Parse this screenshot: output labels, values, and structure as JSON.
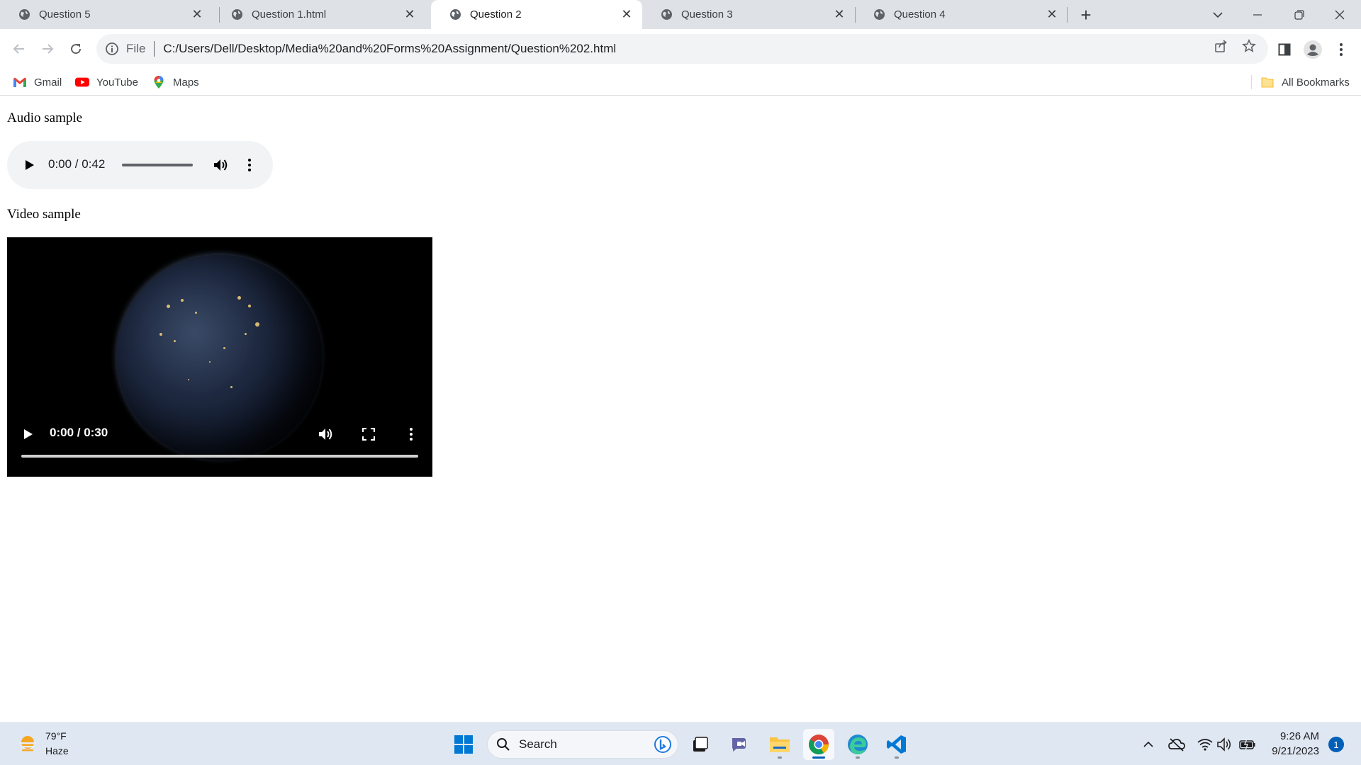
{
  "browser": {
    "tabs": [
      {
        "label": "Question 5",
        "active": false
      },
      {
        "label": "Question 1.html",
        "active": false
      },
      {
        "label": "Question 2",
        "active": true
      },
      {
        "label": "Question 3",
        "active": false
      },
      {
        "label": "Question 4",
        "active": false
      }
    ],
    "close_glyph": "✕",
    "new_tab_glyph": "+",
    "address": {
      "scheme": "File",
      "url": "C:/Users/Dell/Desktop/Media%20and%20Forms%20Assignment/Question%202.html"
    },
    "bookmarks": [
      {
        "label": "Gmail",
        "icon": "gmail-icon"
      },
      {
        "label": "YouTube",
        "icon": "youtube-icon"
      },
      {
        "label": "Maps",
        "icon": "maps-icon"
      }
    ],
    "all_bookmarks_label": "All Bookmarks"
  },
  "page": {
    "audio_heading": "Audio sample",
    "audio": {
      "time": "0:00 / 0:42",
      "progress": 0
    },
    "video_heading": "Video sample",
    "video": {
      "time": "0:00 / 0:30",
      "progress": 0
    }
  },
  "taskbar": {
    "weather": {
      "temp": "79°F",
      "condition": "Haze"
    },
    "search_label": "Search",
    "clock": {
      "time": "9:26 AM",
      "date": "9/21/2023"
    },
    "notification_count": "1",
    "accent": "#005fb8"
  }
}
